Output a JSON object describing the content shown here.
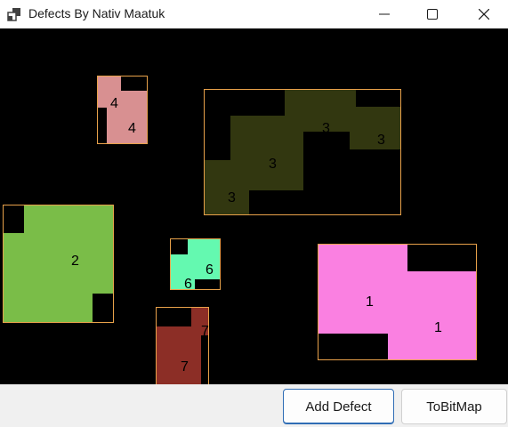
{
  "window": {
    "title": "Defects By Nativ Maatuk",
    "minimize_icon": "minimize-icon",
    "maximize_icon": "maximize-icon",
    "close_icon": "close-icon"
  },
  "canvas": {
    "background": "#000000",
    "defects": [
      {
        "id": 1,
        "fill": "#fa80e1",
        "border": "#e8a14a",
        "labels": [
          "1",
          "1"
        ]
      },
      {
        "id": 2,
        "fill": "#7abd48",
        "border": "#e8a14a",
        "labels": [
          "2"
        ]
      },
      {
        "id": 3,
        "fill": "#323710",
        "border": "#e8a14a",
        "labels": [
          "3",
          "3",
          "3",
          "3"
        ]
      },
      {
        "id": 4,
        "fill": "#d89091",
        "border": "#e8a14a",
        "labels": [
          "4",
          "4"
        ]
      },
      {
        "id": 6,
        "fill": "#64f9b0",
        "border": "#e8a14a",
        "labels": [
          "6",
          "6"
        ]
      },
      {
        "id": 7,
        "fill": "#8c2e26",
        "border": "#e8a14a",
        "labels": [
          "7",
          "7"
        ]
      }
    ]
  },
  "buttons": {
    "add_defect": "Add Defect",
    "to_bitmap": "ToBitMap"
  }
}
